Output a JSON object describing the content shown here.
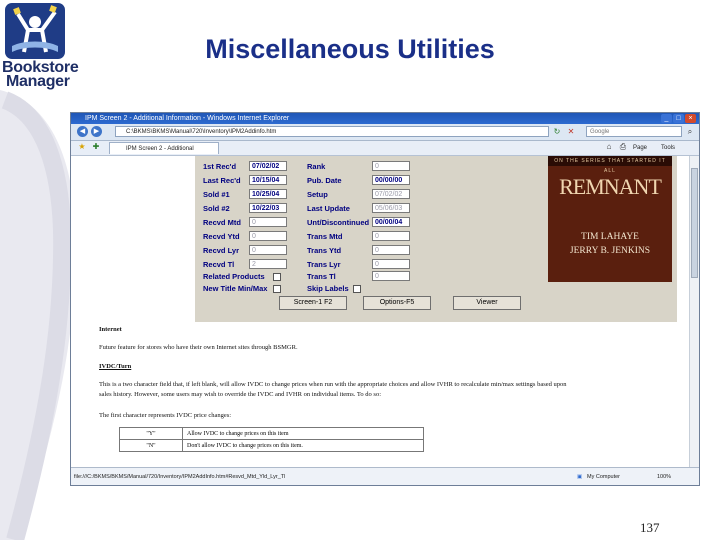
{
  "slide": {
    "title": "Miscellaneous Utilities",
    "logo_line1": "Bookstore",
    "logo_line2": "Manager",
    "page_number": "137"
  },
  "browser": {
    "window_title": "IPM Screen 2 - Additional Information - Windows Internet Explorer",
    "address": "C:\\BKMS\\BKMS\\Manual\\720\\Inventory\\IPM2Addinfo.htm",
    "search_placeholder": "Google",
    "tab_label": "IPM Screen 2 - Additional Information",
    "page_menu": "Page",
    "tools_menu": "Tools",
    "status_path": "file:///C:/BKMS/BKMS/Manual/720/Inventory/IPM2AddInfo.htm#Resvd_Mtd_Yld_Lyr_Tl",
    "status_zone": "My Computer",
    "zoom": "100%"
  },
  "form": {
    "left_labels": [
      "1st Rec'd",
      "Last Rec'd",
      "Sold #1",
      "Sold #2",
      "Recvd Mtd",
      "Recvd Ytd",
      "Recvd Lyr",
      "Recvd Tl",
      "Related Products",
      "New Title Min/Max"
    ],
    "left_values": [
      "07/02/02",
      "10/15/04",
      "10/25/04",
      "10/22/03",
      "0",
      "0",
      "0",
      "2"
    ],
    "mid_labels": [
      "Rank",
      "Pub. Date",
      "Setup",
      "Last Update",
      "Unt/Discontinued",
      "Trans Mtd",
      "Trans Ytd",
      "Trans Lyr",
      "Trans Tl",
      "Skip Labels"
    ],
    "mid_values": [
      "0",
      "00/00/00",
      "07/02/02",
      "05/06/03",
      "00/00/04",
      "0",
      "0",
      "0",
      "0"
    ],
    "buttons": [
      "Screen-1 F2",
      "Options-F5",
      "Viewer"
    ],
    "cover": {
      "series": "ON THE SERIES THAT STARTED IT ALL",
      "title": "REMNANT",
      "author1": "TIM LAHAYE",
      "author2": "JERRY B. JENKINS"
    }
  },
  "doc": {
    "internet_heading": "Internet",
    "internet_text": "Future feature for stores who have their own Internet sites through BSMGR.",
    "ivdc_heading": "IVDC/Turn",
    "ivdc_line1": "This is a two character field that, if left blank, will allow IVDC to change prices when run with the appropriate choices and allow IVHR to recalculate min/max settings based upon",
    "ivdc_line2": "sales history.  However, some users may wish to override the IVDC and IVHR on individual items.  To do so:",
    "first_char_text": "The first character represents IVDC price changes:",
    "rows": [
      {
        "code": "\"Y\"",
        "desc": "Allow IVDC to change prices on this item"
      },
      {
        "code": "\"N\"",
        "desc": "Don't allow IVDC to change prices on this item."
      }
    ]
  }
}
